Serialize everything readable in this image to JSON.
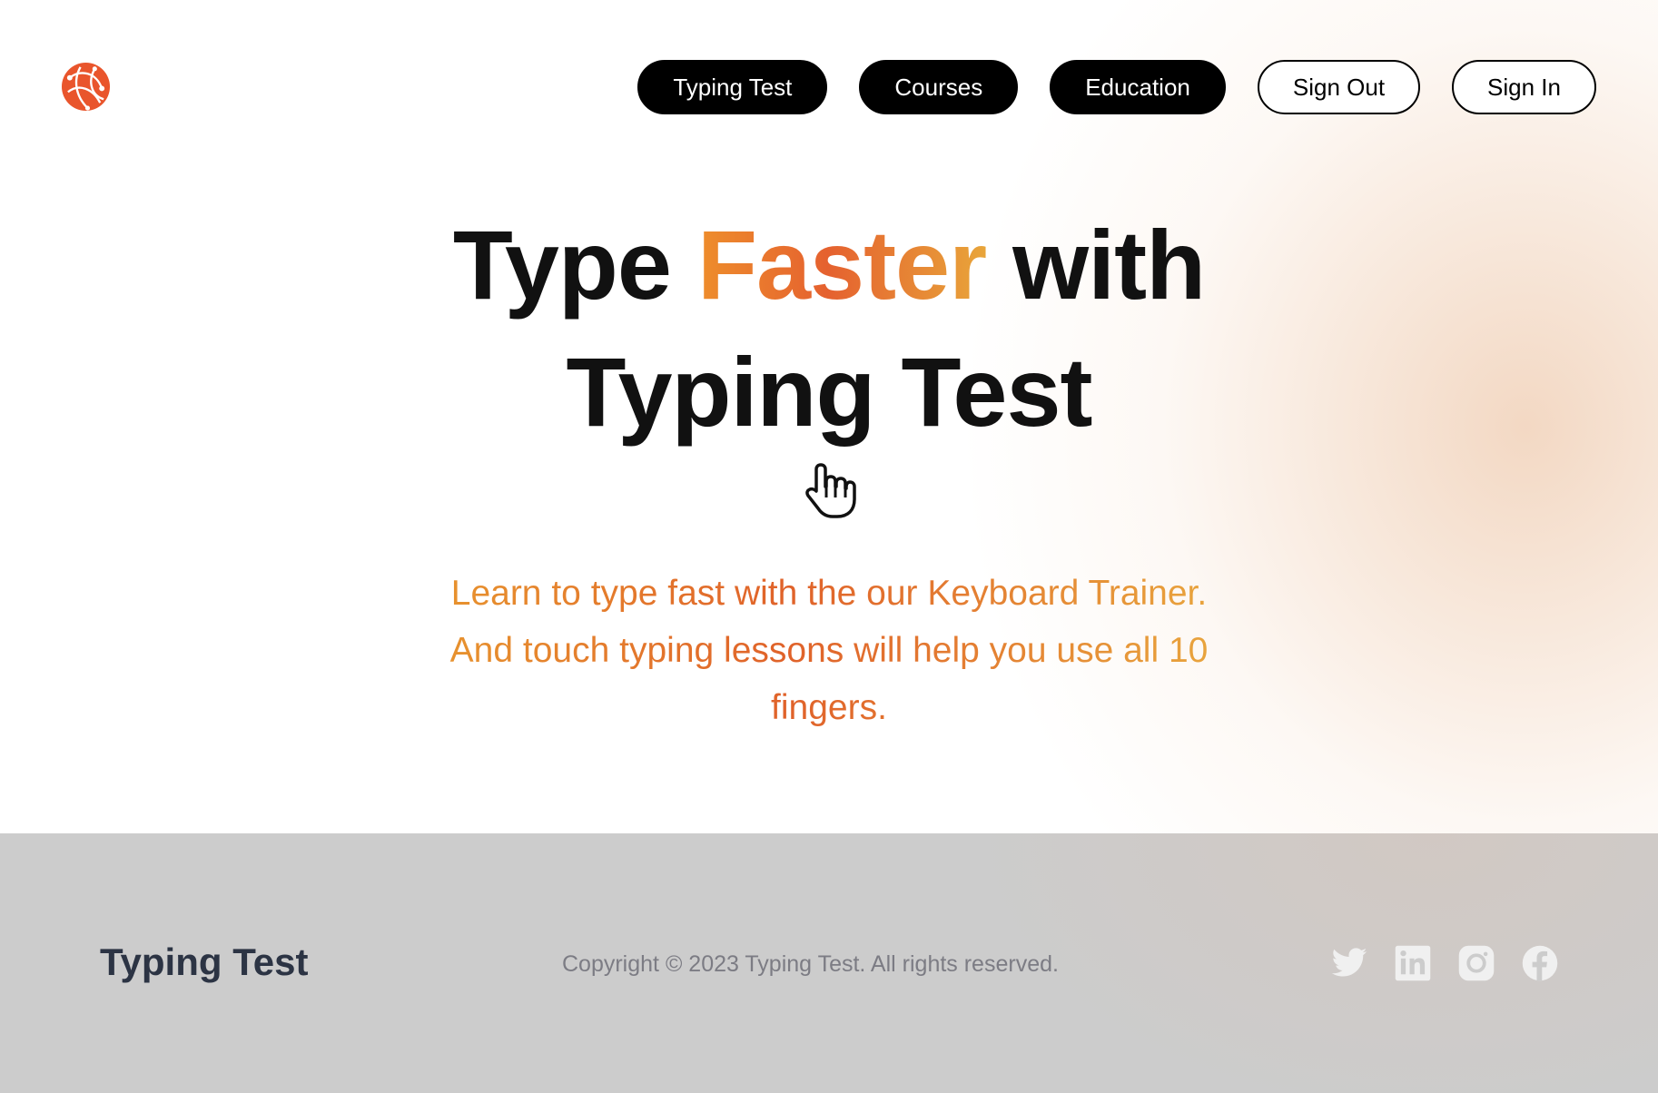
{
  "nav": {
    "items": [
      {
        "label": "Typing Test",
        "style": "dark"
      },
      {
        "label": "Courses",
        "style": "dark"
      },
      {
        "label": "Education",
        "style": "dark"
      },
      {
        "label": "Sign Out",
        "style": "light"
      },
      {
        "label": "Sign In",
        "style": "light"
      }
    ]
  },
  "hero": {
    "title_part1": "Type ",
    "title_accent": "Faster",
    "title_part2": " with",
    "title_line2": "Typing Test",
    "subtitle": "Learn to type fast with the our Keyboard Trainer. And touch typing lessons will help you use all 10 fingers."
  },
  "footer": {
    "brand": "Typing Test",
    "copyright": "Copyright © 2023 Typing Test. All rights reserved.",
    "social": [
      "twitter-icon",
      "linkedin-icon",
      "instagram-icon",
      "facebook-icon"
    ]
  },
  "colors": {
    "logo": "#e9552c",
    "accent_orange": "#e5612f",
    "footer_bg": "#cccccc",
    "social_icon": "#f0f0f0"
  }
}
